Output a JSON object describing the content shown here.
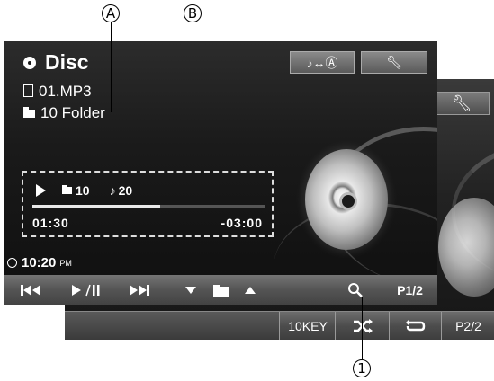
{
  "callouts": {
    "a": "A",
    "b": "B",
    "one": "1"
  },
  "page2": {
    "buttons": [
      {
        "label": "10KEY",
        "icon": ""
      },
      {
        "label": "",
        "icon": "shuffle-icon"
      },
      {
        "label": "",
        "icon": "repeat-icon"
      },
      {
        "label": "P2/2",
        "icon": ""
      }
    ]
  },
  "page1": {
    "source_label": "Disc",
    "file_name": "01.MP3",
    "folder_name": "10 Folder",
    "top_buttons": {
      "sound_toggle_icon": "note-swap-a-icon",
      "setup_icon": "wrench-icon"
    },
    "status": {
      "folder_number": "10",
      "track_number": "20",
      "elapsed": "01:30",
      "remaining": "-03:00",
      "progress": 0.55
    },
    "clock": {
      "time": "10:20",
      "ampm": "PM"
    },
    "controls": [
      {
        "name": "prev-track-button",
        "icon": "skip-back-icon",
        "label": ""
      },
      {
        "name": "play-pause-button",
        "icon": "play-pause-icon",
        "label": ""
      },
      {
        "name": "next-track-button",
        "icon": "skip-forward-icon",
        "label": ""
      },
      {
        "name": "folder-down-up-button",
        "icon": "folder-nav-icon",
        "label": ""
      },
      {
        "name": "search-button",
        "icon": "search-icon",
        "label": ""
      },
      {
        "name": "page-button",
        "icon": "",
        "label": "P1/2"
      }
    ]
  },
  "colors": {
    "screen_bg": "#1a1a1a",
    "button_bg": "#5a5a5a",
    "text": "#ffffff"
  }
}
